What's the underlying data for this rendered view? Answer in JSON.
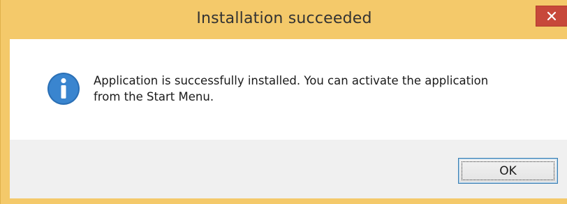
{
  "window": {
    "title": "Installation succeeded",
    "frame_color": "#f4c96a",
    "close_button_color": "#c7483a"
  },
  "message": {
    "icon": "info-icon",
    "text_line1": "Application is successfully installed. You can activate the application",
    "text_line2": "from the Start Menu."
  },
  "buttons": {
    "ok_label": "OK"
  }
}
